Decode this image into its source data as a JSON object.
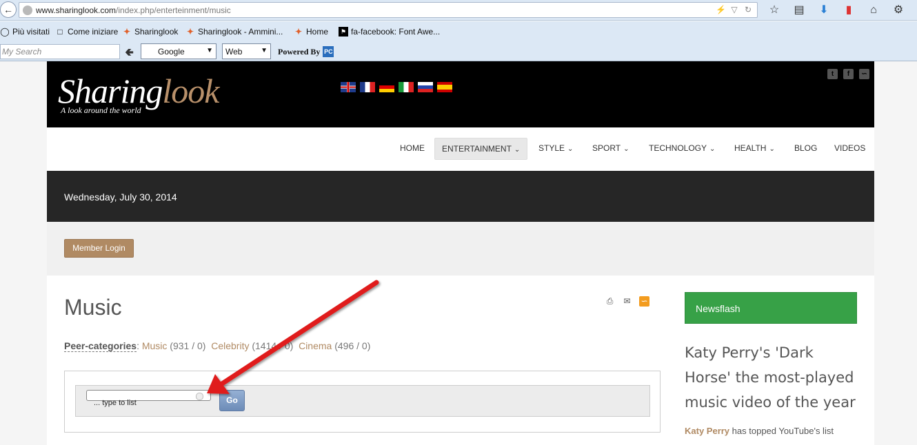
{
  "browser": {
    "url_host": "www.sharinglook.com",
    "url_path": "/index.php/enterteinment/music",
    "bookmarks": [
      {
        "label": "Più visitati",
        "icon": "globe-icon"
      },
      {
        "label": "Come iniziare",
        "icon": "page-icon"
      },
      {
        "label": "Sharinglook",
        "icon": "joomla-icon"
      },
      {
        "label": "Sharinglook - Ammini...",
        "icon": "joomla-icon"
      },
      {
        "label": "Home",
        "icon": "joomla-icon"
      },
      {
        "label": "fa-facebook: Font Awe...",
        "icon": "flag-icon"
      }
    ],
    "search_placeholder": "My Search",
    "engine_select": "Google",
    "type_select": "Web",
    "powered_by": "Powered By"
  },
  "site": {
    "logo_main": "Sharing",
    "logo_accent": "look",
    "tagline": "A look around the world",
    "languages": [
      "English",
      "Français",
      "Deutsch",
      "Italiano",
      "Русский",
      "Español"
    ]
  },
  "nav": {
    "items": [
      {
        "label": "HOME",
        "dropdown": false
      },
      {
        "label": "ENTERTAINMENT",
        "dropdown": true,
        "active": true
      },
      {
        "label": "STYLE",
        "dropdown": true
      },
      {
        "label": "SPORT",
        "dropdown": true
      },
      {
        "label": "TECHNOLOGY",
        "dropdown": true
      },
      {
        "label": "HEALTH",
        "dropdown": true
      },
      {
        "label": "BLOG",
        "dropdown": false
      },
      {
        "label": "VIDEOS",
        "dropdown": false
      }
    ]
  },
  "date": "Wednesday, July 30, 2014",
  "login_button": "Member Login",
  "main": {
    "title": "Music",
    "peer_label": "Peer-categories",
    "peers": [
      {
        "name": "Music",
        "count": "(931 / 0)"
      },
      {
        "name": "Celebrity",
        "count": "(1414 / 0)"
      },
      {
        "name": "Cinema",
        "count": "(496 / 0)"
      }
    ],
    "filter_hint": "... type to list",
    "go_button": "Go"
  },
  "sidebar": {
    "newsflash_label": "Newsflash",
    "news_title": "Katy Perry's 'Dark Horse' the most-played music video of the year",
    "news_highlight": "Katy Perry",
    "news_text": "has topped YouTube's list"
  },
  "colors": {
    "accent": "#b08a63",
    "newsflash": "#37a147",
    "arrow": "#e01b1b"
  }
}
